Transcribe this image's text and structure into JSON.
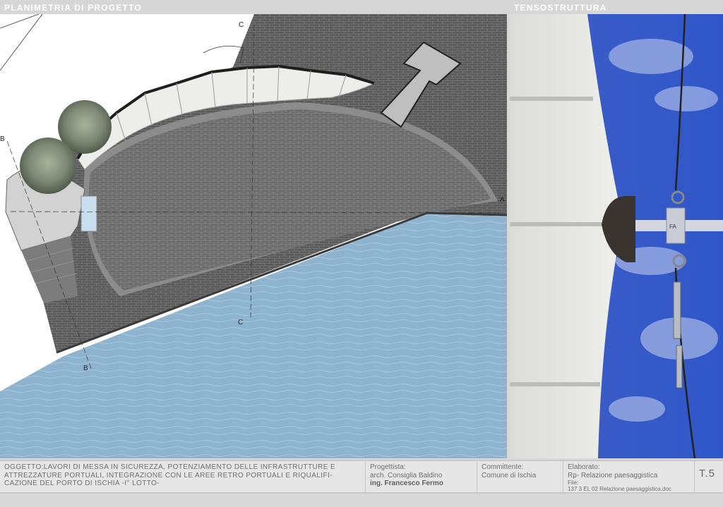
{
  "header": {
    "left_title": "PLANIMETRIA DI PROGETTO",
    "right_title": "TENSOSTRUTTURA"
  },
  "plan": {
    "section_labels": [
      "C",
      "C",
      "B",
      "B",
      "A"
    ]
  },
  "photo": {
    "plate_mark": "FA"
  },
  "footer": {
    "oggetto": "OGGETTO:LAVORI DI MESSA IN SICUREZZA, POTENZIAMENTO DELLE INFRASTRUTTURE E ATTREZZATURE PORTUALI, INTEGRAZIONE CON LE AREE RETRO PORTUALI E RIQUALIFI-CAZIONE DEL PORTO DI ISCHIA -I° LOTTO-",
    "progettista_label": "Progettista:",
    "progettista_1": "arch. Consiglia Baldino",
    "progettista_2": "ing. Francesco Fermo",
    "committente_label": "Committente:",
    "committente": "Comune di Ischia",
    "elaborato_label": "Elaborato:",
    "elaborato": "Rp- Relazione paesaggistica",
    "file_label": "File:",
    "file": "137 3 EL 02 Relazione paesaggistica.doc",
    "tavola": "T.5"
  },
  "colors": {
    "water": "#8fb4cf",
    "paving": "#5d5d5d",
    "sky": "#3e62c8",
    "membrane": "#e9e9e7"
  }
}
